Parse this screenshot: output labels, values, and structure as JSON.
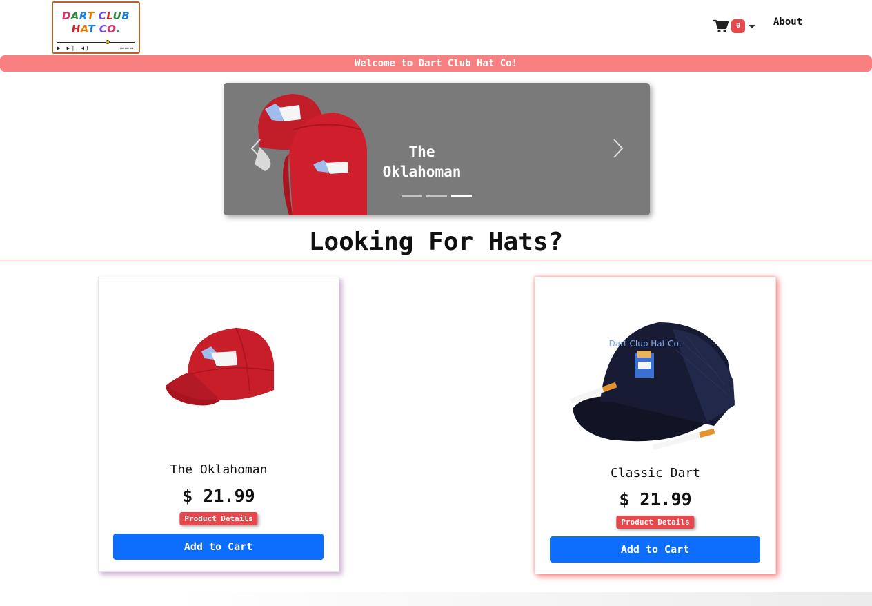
{
  "navbar": {
    "logo": {
      "line1": [
        "DART",
        "CLUB"
      ],
      "line2": [
        "HAT",
        "CO."
      ]
    },
    "cart_count": "0",
    "about_label": "About"
  },
  "banner": {
    "text": "Welcome to Dart Club Hat Co!"
  },
  "carousel": {
    "caption_line1": "The",
    "caption_line2": "Oklahoman",
    "indicators": 3,
    "active_indicator": 3,
    "prev_icon": "chevron-left-icon",
    "next_icon": "chevron-right-icon"
  },
  "main": {
    "heading": "Looking For Hats?"
  },
  "products": [
    {
      "title": "The Oklahoman",
      "price": "$ 21.99",
      "details_label": "Product Details",
      "add_label": "Add to Cart",
      "hat_color": "#c81e2a"
    },
    {
      "title": "Classic Dart",
      "price": "$ 21.99",
      "details_label": "Product Details",
      "add_label": "Add to Cart",
      "hat_color": "#14182e",
      "embroidery": "Dart Club Hat Co."
    }
  ],
  "colors": {
    "banner": "#f98080",
    "accent_red": "#e5484d",
    "primary_blue": "#0d6efd",
    "carousel_bg": "#7a7a7a"
  }
}
